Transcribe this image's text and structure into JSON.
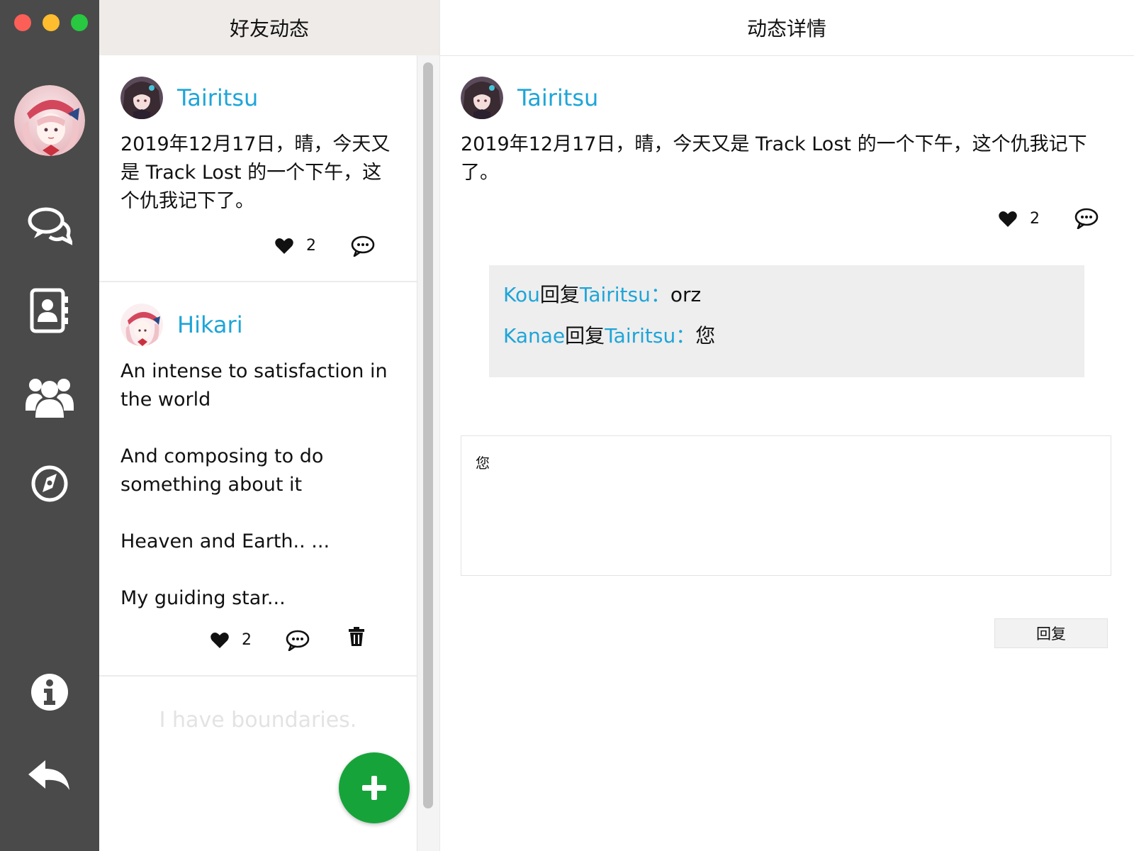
{
  "app": {
    "window_controls": [
      "close",
      "minimize",
      "maximize"
    ],
    "accent_color": "#1ea5d8",
    "fab_color": "#16a43a"
  },
  "sidebar": {
    "items": [
      {
        "name": "chat",
        "icon": "chat-bubbles-icon"
      },
      {
        "name": "contacts",
        "icon": "contact-book-icon"
      },
      {
        "name": "groups",
        "icon": "group-icon"
      },
      {
        "name": "discover",
        "icon": "compass-icon"
      }
    ],
    "bottom_items": [
      {
        "name": "about",
        "icon": "info-icon"
      },
      {
        "name": "back",
        "icon": "back-arrow-icon"
      }
    ]
  },
  "feed": {
    "title": "好友动态",
    "posts": [
      {
        "user": "Tairitsu",
        "text": [
          "2019年12月17日，晴，今天又是 Track Lost 的一个下午，这个仇我记下了。"
        ],
        "likes": "2"
      },
      {
        "user": "Hikari",
        "text": [
          "An intense to satisfaction in the world",
          "And composing to do something about it",
          "Heaven and Earth.. ...",
          "My guiding star..."
        ],
        "likes": "2"
      }
    ],
    "end_text": "I have boundaries.",
    "fab_label": "+"
  },
  "detail": {
    "title": "动态详情",
    "user": "Tairitsu",
    "text": "2019年12月17日，晴，今天又是 Track Lost 的一个下午，这个仇我记下了。",
    "likes": "2",
    "comments": [
      {
        "from": "Kou",
        "verb": "回复",
        "to": "Tairitsu",
        "sep": "：",
        "content": "orz"
      },
      {
        "from": "Kanae",
        "verb": "回复",
        "to": "Tairitsu",
        "sep": "：",
        "content": "您"
      }
    ],
    "reply_input_value": "您",
    "reply_button": "回复"
  }
}
